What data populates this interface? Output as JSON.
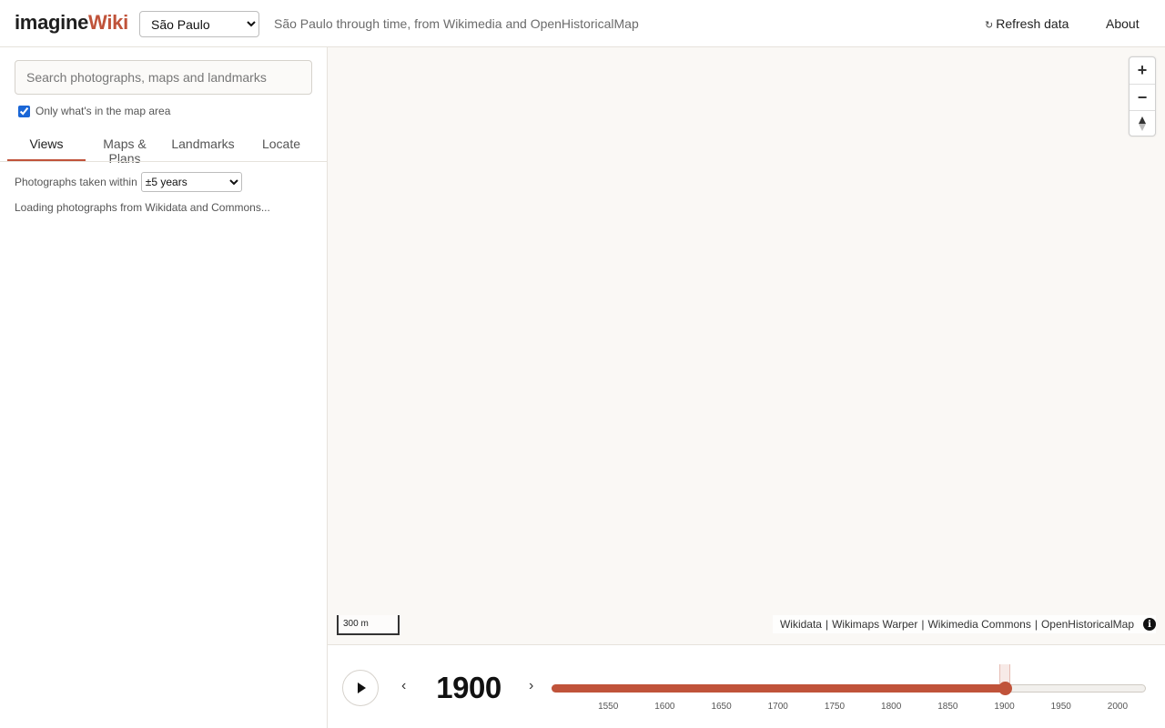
{
  "header": {
    "logo_part1": "imagine",
    "logo_part2": "Wiki",
    "city_selected": "São Paulo",
    "tagline": "São Paulo through time, from Wikimedia and OpenHistoricalMap",
    "refresh_label": "Refresh data",
    "refresh_icon": "refresh-icon",
    "about_label": "About"
  },
  "sidebar": {
    "search_placeholder": "Search photographs, maps and landmarks",
    "only_map_area_label": "Only what's in the map area",
    "only_map_area_checked": true,
    "tabs": [
      {
        "label": "Views",
        "active": true
      },
      {
        "label": "Maps & Plans",
        "active": false
      },
      {
        "label": "Landmarks",
        "active": false
      },
      {
        "label": "Locate",
        "active": false
      }
    ],
    "within_label": "Photographs taken within",
    "within_selected": "±5 years",
    "loading_text": "Loading photographs from Wikidata and Commons..."
  },
  "map": {
    "zoom_in": "+",
    "zoom_out": "−",
    "compass": "compass-icon",
    "scale_label": "300 m",
    "attribution": [
      "Wikidata",
      "Wikimaps Warper",
      "Wikimedia Commons",
      "OpenHistoricalMap"
    ],
    "attribution_sep": "|",
    "info": "i"
  },
  "timeline": {
    "prev": "‹",
    "next": "›",
    "year": "1900",
    "min_year": 1500,
    "max_year": 2025,
    "current_year": 1900,
    "ticks": [
      1550,
      1600,
      1650,
      1700,
      1750,
      1800,
      1850,
      1900,
      1950,
      2000
    ],
    "accent_color": "#c0533a"
  }
}
